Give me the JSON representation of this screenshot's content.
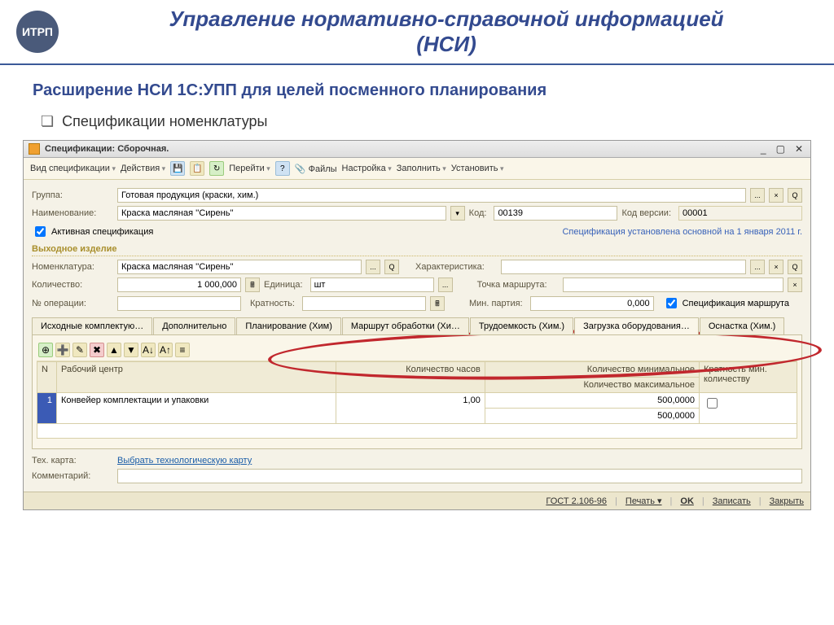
{
  "slide": {
    "logo_text": "ИТРП",
    "title_line1": "Управление нормативно-справочной информацией",
    "title_line2": "(НСИ)",
    "subtitle": "Расширение НСИ 1С:УПП для целей посменного планирования",
    "bullet": "Спецификации номенклатуры"
  },
  "window": {
    "title": "Спецификации: Сборочная."
  },
  "toolbar": {
    "spec_type": "Вид спецификации",
    "actions": "Действия",
    "goto": "Перейти",
    "files": "Файлы",
    "settings": "Настройка",
    "fill": "Заполнить",
    "set": "Установить"
  },
  "form": {
    "group_lbl": "Группа:",
    "group_val": "Готовая продукция (краски, хим.)",
    "name_lbl": "Наименование:",
    "name_val": "Краска масляная ''Сирень''",
    "code_lbl": "Код:",
    "code_val": "00139",
    "ver_lbl": "Код версии:",
    "ver_val": "00001",
    "active_lbl": "Активная спецификация",
    "status_note": "Спецификация установлена основной на 1 января 2011 г.",
    "out_section": "Выходное изделие",
    "nomen_lbl": "Номенклатура:",
    "nomen_val": "Краска масляная ''Сирень''",
    "char_lbl": "Характеристика:",
    "qty_lbl": "Количество:",
    "qty_val": "1 000,000",
    "unit_lbl": "Единица:",
    "unit_val": "шт",
    "route_point_lbl": "Точка маршрута:",
    "opnum_lbl": "№ операции:",
    "mult_lbl": "Кратность:",
    "minlot_lbl": "Мин. партия:",
    "minlot_val": "0,000",
    "spec_route_lbl": "Спецификация маршрута"
  },
  "tabs": {
    "t0": "Исходные комплектую…",
    "t1": "Дополнительно",
    "t2": "Планирование (Хим)",
    "t3": "Маршрут обработки (Хи…",
    "t4": "Трудоемкость (Хим.)",
    "t5": "Загрузка оборудования…",
    "t6": "Оснастка (Хим.)"
  },
  "table": {
    "h_n": "N",
    "h_workcenter": "Рабочий центр",
    "h_hours": "Количество часов",
    "h_min": "Количество минимальное",
    "h_max": "Количество максимальное",
    "h_kratn": "Кратность мин. количеству",
    "r1_n": "1",
    "r1_wc": "Конвейер комплектации и упаковки",
    "r1_hours": "1,00",
    "r1_qty1": "500,0000",
    "r1_qty2": "500,0000"
  },
  "footer": {
    "techmap_lbl": "Тех. карта:",
    "techmap_link": "Выбрать технологическую карту",
    "comment_lbl": "Комментарий:"
  },
  "statusbar": {
    "gost": "ГОСТ 2.106-96",
    "print": "Печать",
    "ok": "OK",
    "save": "Записать",
    "close": "Закрыть"
  }
}
